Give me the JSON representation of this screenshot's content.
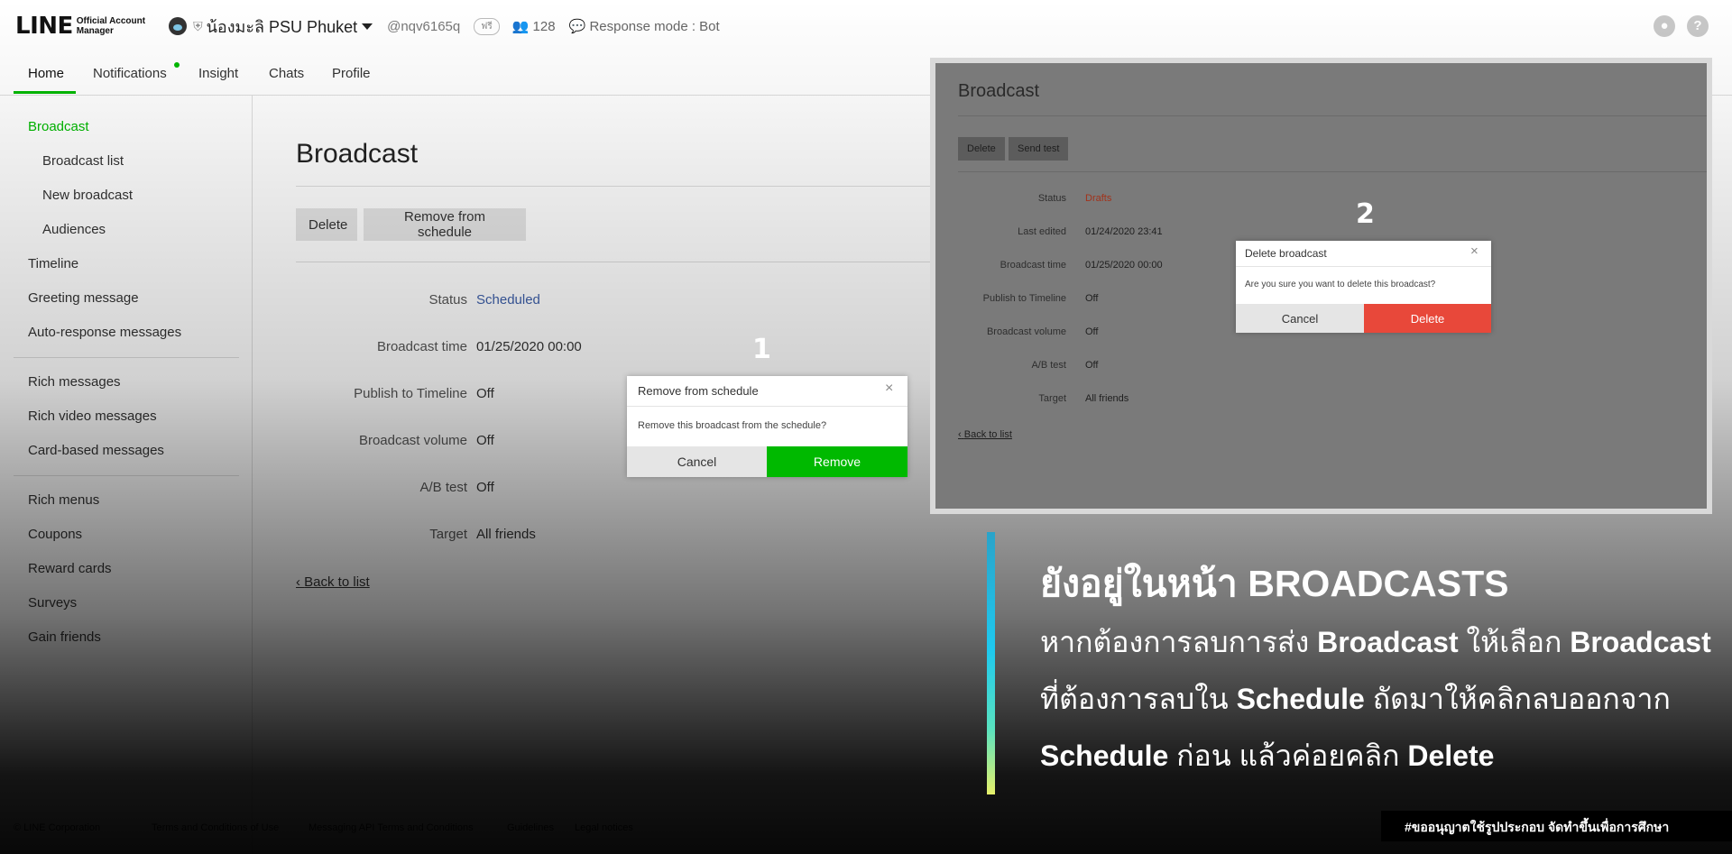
{
  "header": {
    "logo_main": "LINE",
    "logo_sub_1": "Official Account",
    "logo_sub_2": "Manager",
    "account_name": "น้องมะลิ PSU Phuket",
    "account_id": "@nqv6165q",
    "plan_badge": "ฟรี",
    "friends_count": "128",
    "response_mode": "Response mode : Bot"
  },
  "nav": {
    "tabs": [
      "Home",
      "Notifications",
      "Insight",
      "Chats",
      "Profile"
    ],
    "active": "Home"
  },
  "sidebar": {
    "items": [
      "Broadcast",
      "Broadcast list",
      "New broadcast",
      "Audiences",
      "Timeline",
      "Greeting message",
      "Auto-response messages",
      "Rich messages",
      "Rich video messages",
      "Card-based messages",
      "Rich menus",
      "Coupons",
      "Reward cards",
      "Surveys",
      "Gain friends"
    ],
    "active": "Broadcast"
  },
  "main": {
    "title": "Broadcast",
    "delete_label": "Delete",
    "remove_label": "Remove from schedule",
    "details": [
      {
        "label": "Status",
        "value": "Scheduled"
      },
      {
        "label": "Broadcast time",
        "value": "01/25/2020 00:00"
      },
      {
        "label": "Publish to Timeline",
        "value": "Off"
      },
      {
        "label": "Broadcast volume",
        "value": "Off"
      },
      {
        "label": "A/B test",
        "value": "Off"
      },
      {
        "label": "Target",
        "value": "All friends"
      }
    ],
    "back_label": "Back to list"
  },
  "modal_remove": {
    "step": "1",
    "title": "Remove from schedule",
    "body": "Remove this broadcast from the schedule?",
    "cancel_label": "Cancel",
    "confirm_label": "Remove"
  },
  "inset": {
    "title": "Broadcast",
    "delete_label": "Delete",
    "send_test_label": "Send test",
    "details": [
      {
        "label": "Status",
        "value": "Drafts"
      },
      {
        "label": "Last edited",
        "value": "01/24/2020 23:41"
      },
      {
        "label": "Broadcast time",
        "value": "01/25/2020 00:00"
      },
      {
        "label": "Publish to Timeline",
        "value": "Off"
      },
      {
        "label": "Broadcast volume",
        "value": "Off"
      },
      {
        "label": "A/B test",
        "value": "Off"
      },
      {
        "label": "Target",
        "value": "All friends"
      }
    ],
    "back_label": "Back to list"
  },
  "modal_delete": {
    "step": "2",
    "title": "Delete broadcast",
    "body": "Are you sure you want to delete this broadcast?",
    "cancel_label": "Cancel",
    "confirm_label": "Delete"
  },
  "annotation": {
    "headline": "ยังอยู่ในหน้า BROADCASTS",
    "l1a": "หากต้องการลบการส่ง ",
    "l1b": "Broadcast",
    "l1c": " ให้เลือก ",
    "l1d": "Broadcast",
    "l2a": "ที่ต้องการลบใน ",
    "l2b": "Schedule",
    "l2c": " ถัดมาให้คลิกลบออกจาก",
    "l3a": "Schedule",
    "l3b": " ก่อน แล้วค่อยคลิก ",
    "l3c": "Delete",
    "credit": "#ขออนุญาตใช้รูปประกอบ จัดทำขึ้นเพื่อการศึกษา"
  },
  "footer": {
    "items": [
      "© LINE Corporation",
      "Terms and Conditions of Use",
      "Messaging API Terms and Conditions",
      "Guidelines",
      "Legal notices"
    ]
  },
  "colors": {
    "line_green": "#00b900",
    "delete_red": "#e8483a",
    "status_blue": "#3c5ea8"
  }
}
